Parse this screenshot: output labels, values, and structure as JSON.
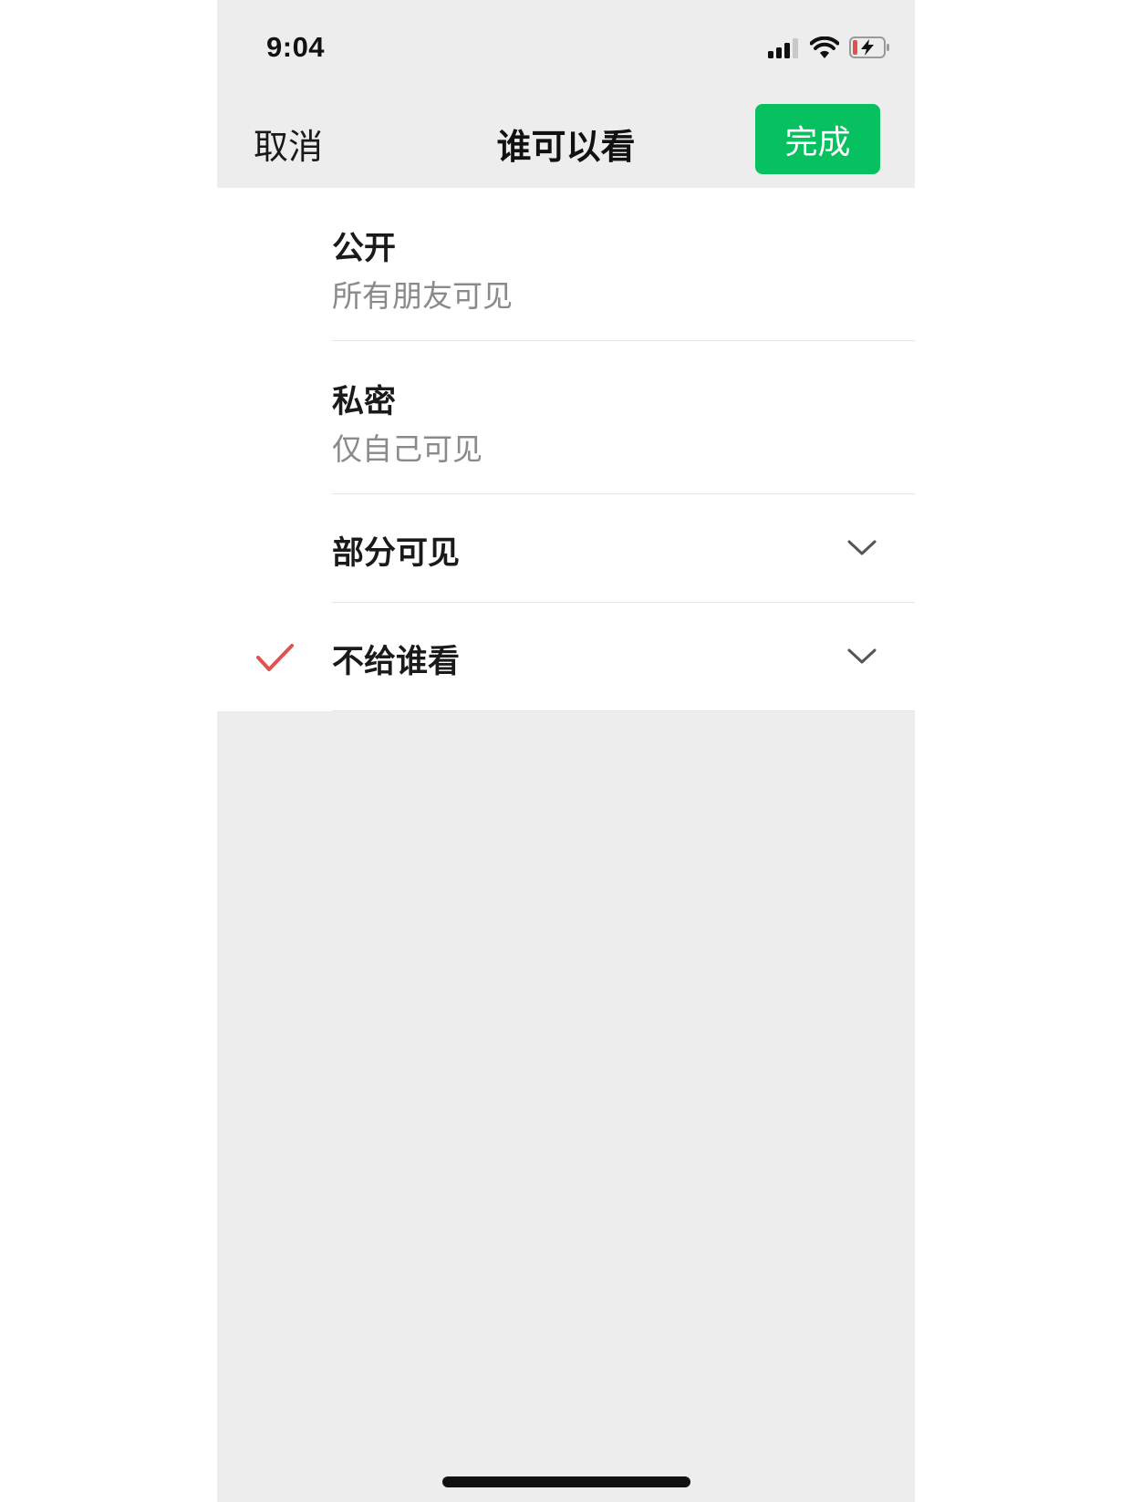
{
  "status_bar": {
    "time": "9:04",
    "icons": [
      "signal-icon",
      "wifi-icon",
      "battery-charging-icon"
    ]
  },
  "nav": {
    "cancel_label": "取消",
    "title": "谁可以看",
    "done_label": "完成",
    "done_color": "#07c160"
  },
  "options": [
    {
      "title": "公开",
      "subtitle": "所有朋友可见",
      "selected": false,
      "expandable": false
    },
    {
      "title": "私密",
      "subtitle": "仅自己可见",
      "selected": false,
      "expandable": false
    },
    {
      "title": "部分可见",
      "selected": false,
      "expandable": true,
      "icon": "chevron-down-icon"
    },
    {
      "title": "不给谁看",
      "selected": true,
      "expandable": true,
      "icon": "chevron-down-icon",
      "selected_icon": "check-icon"
    }
  ],
  "colors": {
    "accent": "#07c160",
    "check": "#e0524d",
    "background": "#ededed"
  }
}
